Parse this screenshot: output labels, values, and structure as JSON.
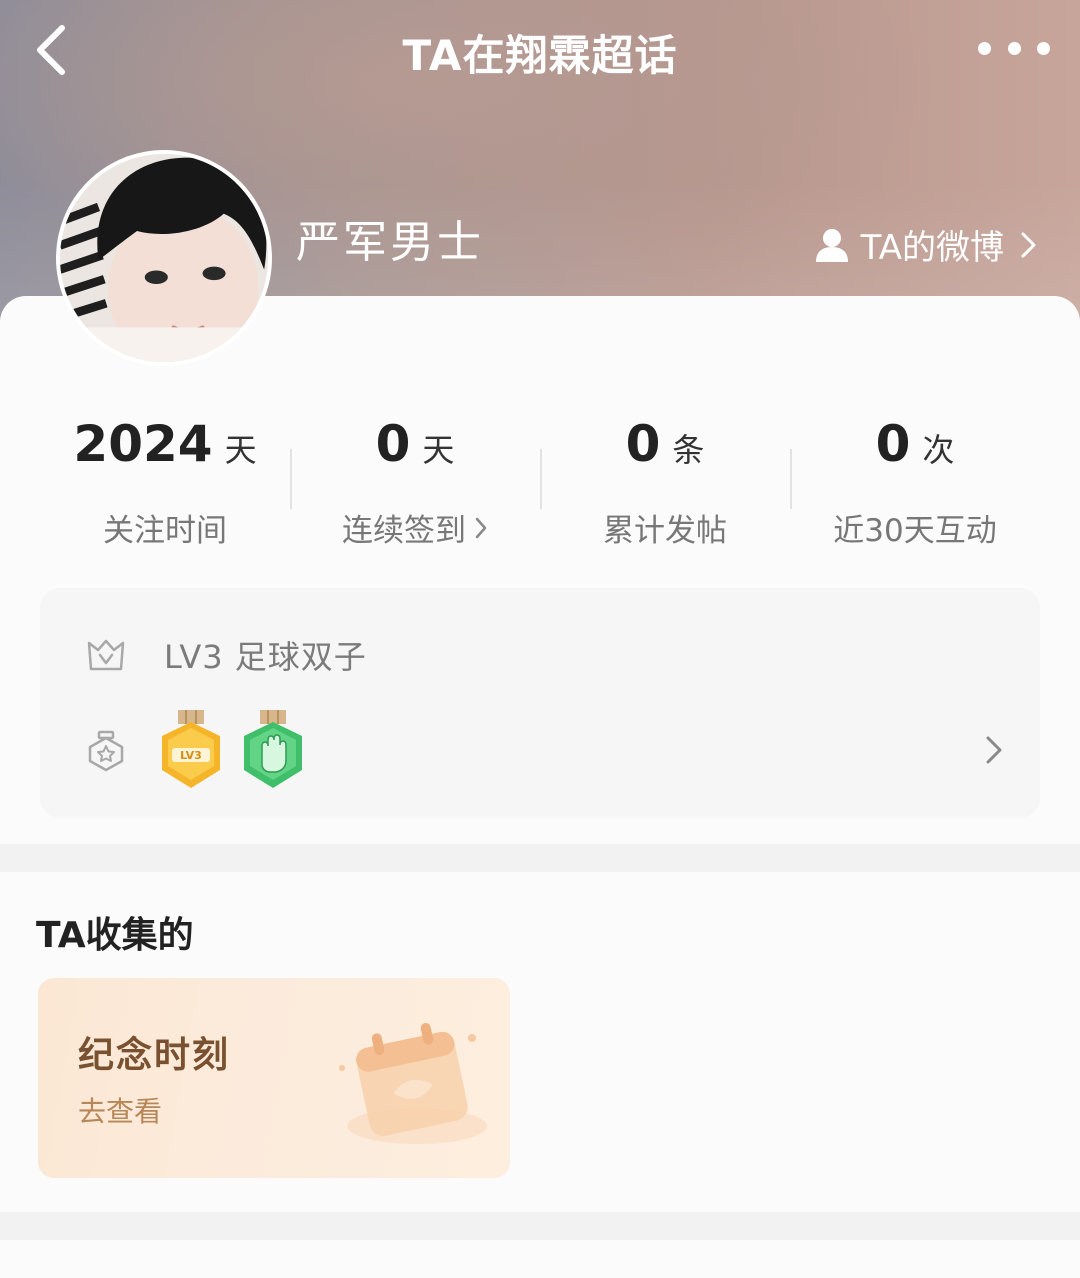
{
  "nav": {
    "title": "TA在翔霖超话"
  },
  "profile": {
    "username": "严军男士",
    "weibo_link": "TA的微博"
  },
  "stats": [
    {
      "value": "2024",
      "unit": "天",
      "label": "关注时间"
    },
    {
      "value": "0",
      "unit": "天",
      "label": "连续签到"
    },
    {
      "value": "0",
      "unit": "条",
      "label": "累计发帖"
    },
    {
      "value": "0",
      "unit": "次",
      "label": "近30天互动"
    }
  ],
  "level": {
    "text": "LV3  足球双子",
    "medals": [
      "LV3",
      "hand-medal"
    ]
  },
  "collections": {
    "title": "TA收集的",
    "card_title": "纪念时刻",
    "card_action": "去查看"
  },
  "colors": {
    "hero_start": "#8e8d99",
    "hero_end": "#c7a59b",
    "card_bg": "#fbfbfb",
    "memory_title": "#7a5130",
    "memory_sub": "#b78758"
  }
}
